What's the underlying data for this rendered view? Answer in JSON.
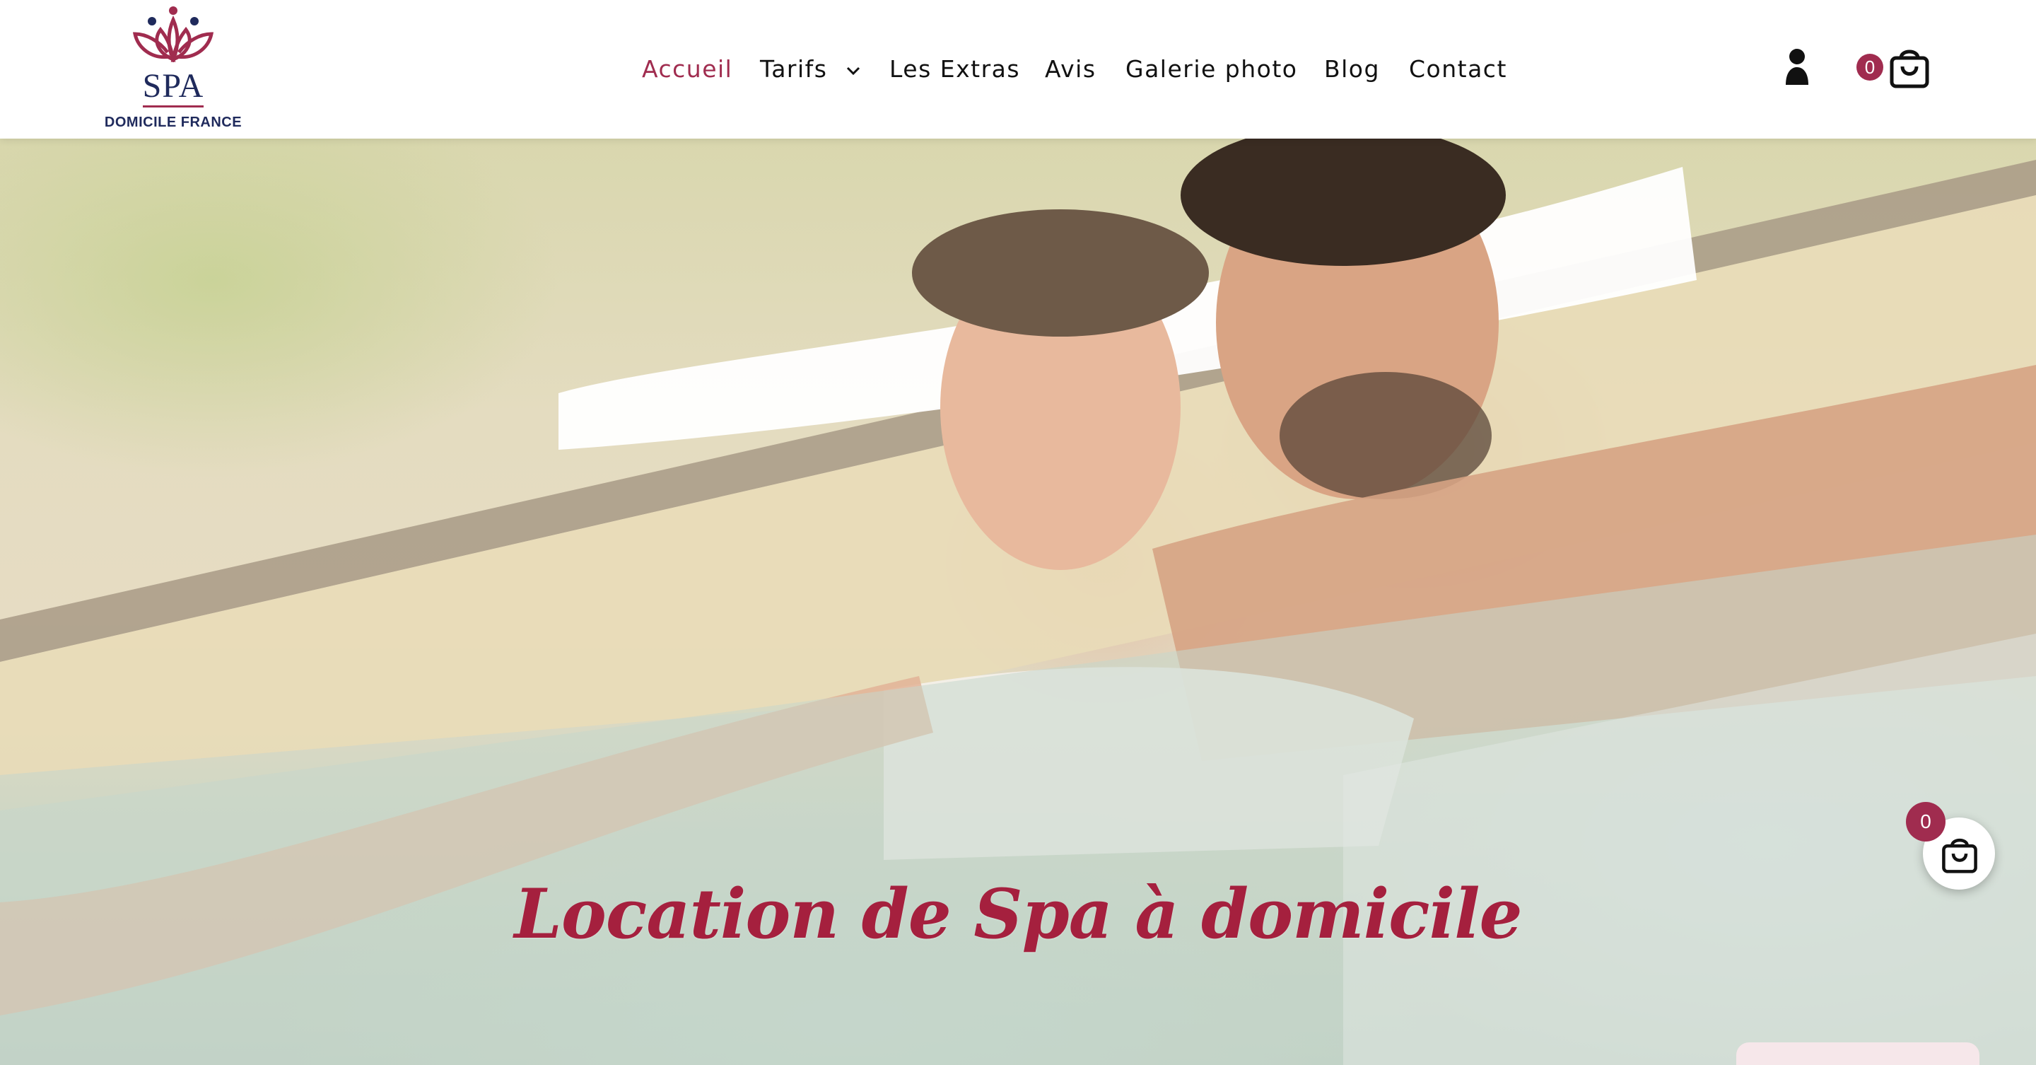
{
  "brand": {
    "name": "SPA",
    "subtitle": "DOMICILE FRANCE",
    "colors": {
      "accent": "#a02c4f",
      "navy": "#1f2a5c",
      "hero_title": "#a5203e"
    }
  },
  "nav": {
    "items": [
      {
        "label": "Accueil",
        "active": true
      },
      {
        "label": "Tarifs",
        "has_dropdown": true
      },
      {
        "label": "Les Extras"
      },
      {
        "label": "Avis"
      },
      {
        "label": "Galerie photo"
      },
      {
        "label": "Blog"
      },
      {
        "label": "Contact"
      }
    ]
  },
  "header_actions": {
    "account_icon": "user-icon",
    "cart_icon": "shopping-bag-icon",
    "cart_count": "0"
  },
  "hero": {
    "title": "Location de Spa à domicile",
    "image": "couple-relaxing-in-hot-tub"
  },
  "floating_cart": {
    "icon": "shopping-bag-icon",
    "count": "0"
  }
}
